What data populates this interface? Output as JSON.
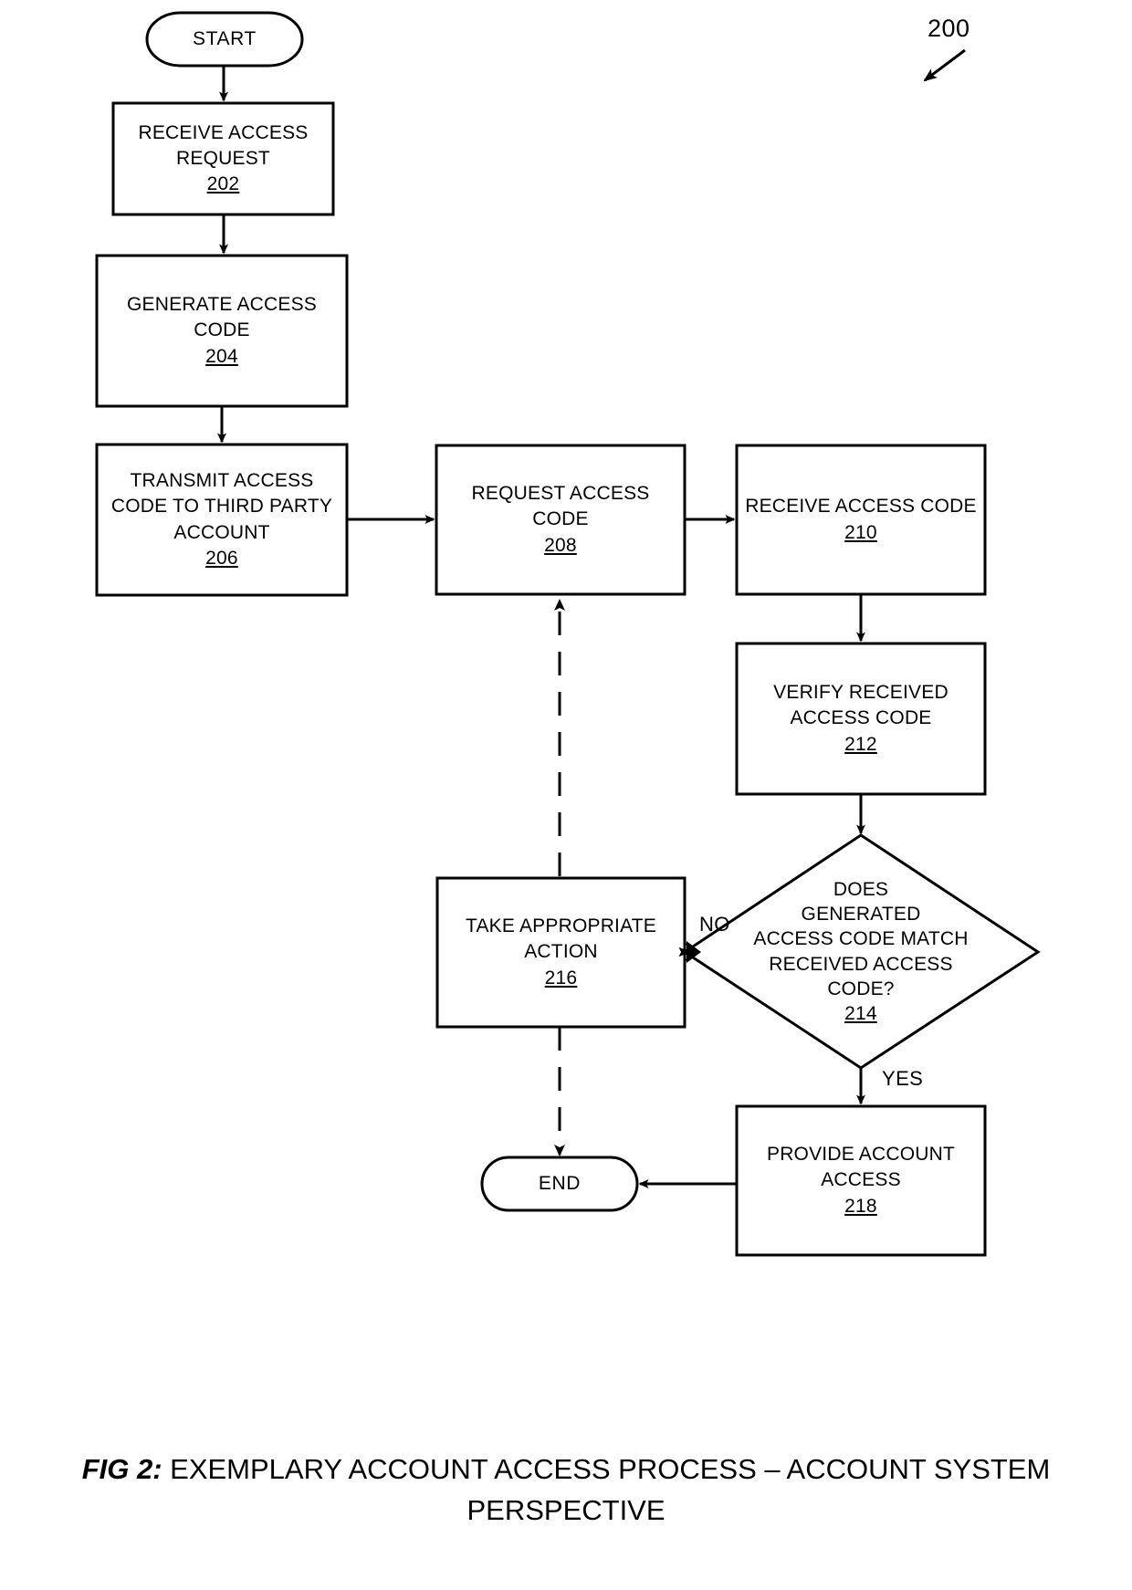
{
  "figure": {
    "reference_numeral": "200",
    "caption_prefix": "FIG 2:",
    "caption_text": "EXEMPLARY ACCOUNT ACCESS PROCESS – ACCOUNT SYSTEM PERSPECTIVE"
  },
  "nodes": {
    "start": {
      "label": "START",
      "shape": "terminal"
    },
    "n202": {
      "line1": "RECEIVE ACCESS",
      "line2": "REQUEST",
      "ref": "202",
      "shape": "process"
    },
    "n204": {
      "line1": "GENERATE ACCESS",
      "line2": "CODE",
      "ref": "204",
      "shape": "process"
    },
    "n206": {
      "line1": "TRANSMIT ACCESS",
      "line2": "CODE TO THIRD PARTY",
      "line3": "ACCOUNT",
      "ref": "206",
      "shape": "process"
    },
    "n208": {
      "line1": "REQUEST ACCESS",
      "line2": "CODE",
      "ref": "208",
      "shape": "process"
    },
    "n210": {
      "line1": "RECEIVE ACCESS CODE",
      "ref": "210",
      "shape": "process"
    },
    "n212": {
      "line1": "VERIFY RECEIVED",
      "line2": "ACCESS CODE",
      "ref": "212",
      "shape": "process"
    },
    "n214": {
      "line1": "DOES",
      "line2": "GENERATED",
      "line3": "ACCESS CODE MATCH",
      "line4": "RECEIVED ACCESS",
      "line5": "CODE?",
      "ref": "214",
      "shape": "decision"
    },
    "n216": {
      "line1": "TAKE APPROPRIATE",
      "line2": "ACTION",
      "ref": "216",
      "shape": "process"
    },
    "n218": {
      "line1": "PROVIDE ACCOUNT",
      "line2": "ACCESS",
      "ref": "218",
      "shape": "process"
    },
    "end": {
      "label": "END",
      "shape": "terminal"
    }
  },
  "edge_labels": {
    "no": "NO",
    "yes": "YES"
  },
  "colors": {
    "stroke": "#000000",
    "background": "#ffffff"
  }
}
